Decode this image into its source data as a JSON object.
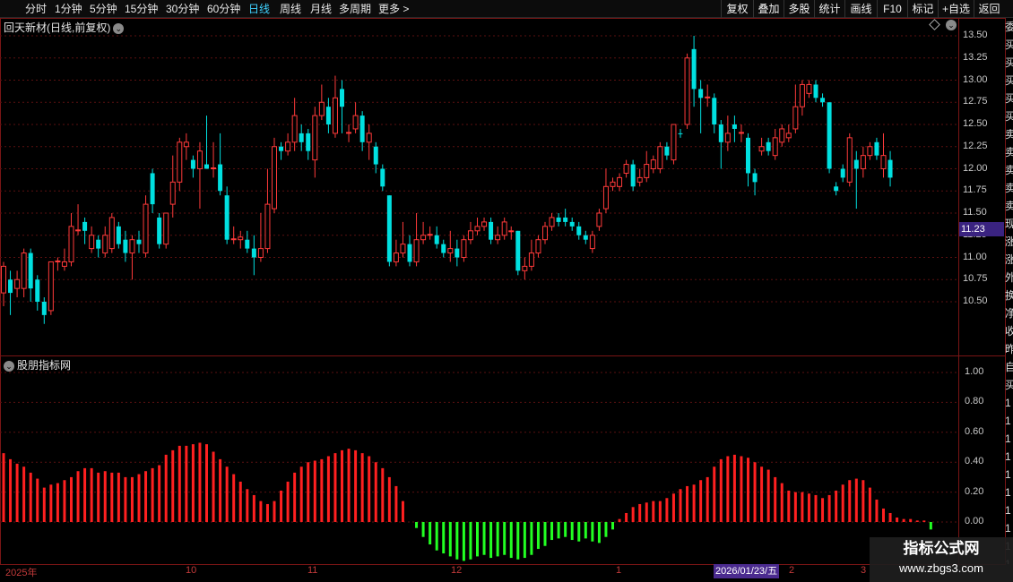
{
  "toolbar": {
    "periods": [
      "分时",
      "1分钟",
      "5分钟",
      "15分钟",
      "30分钟",
      "60分钟",
      "日线",
      "周线",
      "月线",
      "多周期",
      "更多"
    ],
    "active_period": "日线",
    "more_arrow": ">",
    "right_buttons": [
      "复权",
      "叠加",
      "多股",
      "统计",
      "画线",
      "F10",
      "标记",
      "+自选",
      "返回"
    ]
  },
  "main_pane": {
    "title": "回天新材(日线,前复权)",
    "price_ticks": [
      "13.50",
      "13.25",
      "13.00",
      "12.75",
      "12.50",
      "12.25",
      "12.00",
      "11.75",
      "11.50",
      "11.25",
      "11.00",
      "10.75",
      "10.50"
    ],
    "last_price": "11.23"
  },
  "indicator_pane": {
    "title": "股朋指标网",
    "ticks": [
      "1.00",
      "0.80",
      "0.60",
      "0.40",
      "0.20",
      "0.00"
    ]
  },
  "x_axis": {
    "labels": [
      "2025年",
      "10",
      "11",
      "12",
      "1",
      "2",
      "3"
    ],
    "cursor_date": "2026/01/23/五"
  },
  "edge_strip": {
    "chars": [
      "委",
      "买",
      "买",
      "买",
      "买",
      "买",
      "卖",
      "卖",
      "卖",
      "卖",
      "卖",
      "现",
      "涨",
      "涨",
      "外",
      "换",
      "净",
      "收",
      "昨",
      "自",
      "买",
      "1",
      "1",
      "1",
      "1",
      "1",
      "1",
      "1",
      "1",
      "1",
      "1"
    ]
  },
  "watermark": {
    "title": "指标公式网",
    "url": "www.zbgs3.com"
  },
  "colors": {
    "up": "#ff3a3a",
    "down": "#00e0e0",
    "grid": "#5a1010",
    "osc_up": "#ff2020",
    "osc_down": "#22ff22",
    "active_tab": "#3fd2ff"
  },
  "chart_data": [
    {
      "type": "candlestick",
      "title": "回天新材(日线,前复权)",
      "ylim": [
        10.25,
        13.5
      ],
      "candles": [
        {
          "o": 10.6,
          "c": 10.9,
          "h": 10.95,
          "l": 10.45
        },
        {
          "o": 10.75,
          "c": 10.6,
          "h": 10.85,
          "l": 10.35
        },
        {
          "o": 10.65,
          "c": 10.75,
          "h": 10.85,
          "l": 10.55
        },
        {
          "o": 10.65,
          "c": 11.05,
          "h": 11.1,
          "l": 10.55
        },
        {
          "o": 11.05,
          "c": 10.65,
          "h": 11.1,
          "l": 10.5
        },
        {
          "o": 10.75,
          "c": 10.5,
          "h": 10.8,
          "l": 10.4
        },
        {
          "o": 10.5,
          "c": 10.35,
          "h": 10.55,
          "l": 10.25
        },
        {
          "o": 10.4,
          "c": 10.95,
          "h": 10.95,
          "l": 10.35
        },
        {
          "o": 10.95,
          "c": 10.96,
          "h": 11.0,
          "l": 10.85
        },
        {
          "o": 10.9,
          "c": 10.95,
          "h": 11.1,
          "l": 10.85
        },
        {
          "o": 10.95,
          "c": 11.35,
          "h": 11.5,
          "l": 10.9
        },
        {
          "o": 11.3,
          "c": 11.31,
          "h": 11.6,
          "l": 11.25
        },
        {
          "o": 11.4,
          "c": 11.3,
          "h": 11.45,
          "l": 11.15
        },
        {
          "o": 11.1,
          "c": 11.25,
          "h": 11.35,
          "l": 11.05
        },
        {
          "o": 11.2,
          "c": 11.1,
          "h": 11.25,
          "l": 11.0
        },
        {
          "o": 11.05,
          "c": 11.25,
          "h": 11.35,
          "l": 11.0
        },
        {
          "o": 11.1,
          "c": 11.45,
          "h": 11.5,
          "l": 11.05
        },
        {
          "o": 11.35,
          "c": 11.15,
          "h": 11.4,
          "l": 11.1
        },
        {
          "o": 11.2,
          "c": 11.05,
          "h": 11.3,
          "l": 10.95
        },
        {
          "o": 11.05,
          "c": 11.2,
          "h": 11.25,
          "l": 10.75
        },
        {
          "o": 11.2,
          "c": 11.15,
          "h": 11.3,
          "l": 11.05
        },
        {
          "o": 11.05,
          "c": 11.6,
          "h": 11.7,
          "l": 11.0
        },
        {
          "o": 11.95,
          "c": 11.6,
          "h": 12.0,
          "l": 11.5
        },
        {
          "o": 11.45,
          "c": 11.15,
          "h": 11.5,
          "l": 11.1
        },
        {
          "o": 11.15,
          "c": 11.5,
          "h": 11.5,
          "l": 11.1
        },
        {
          "o": 11.6,
          "c": 11.85,
          "h": 12.15,
          "l": 11.45
        },
        {
          "o": 11.85,
          "c": 12.3,
          "h": 12.35,
          "l": 11.75
        },
        {
          "o": 12.25,
          "c": 12.3,
          "h": 12.4,
          "l": 12.1
        },
        {
          "o": 12.1,
          "c": 12.0,
          "h": 12.15,
          "l": 11.9
        },
        {
          "o": 12.0,
          "c": 12.2,
          "h": 12.3,
          "l": 11.55
        },
        {
          "o": 12.05,
          "c": 12.0,
          "h": 12.6,
          "l": 12.0
        },
        {
          "o": 12.0,
          "c": 12.01,
          "h": 12.3,
          "l": 11.9
        },
        {
          "o": 12.05,
          "c": 11.75,
          "h": 12.4,
          "l": 11.7
        },
        {
          "o": 11.7,
          "c": 11.2,
          "h": 11.8,
          "l": 11.15
        },
        {
          "o": 11.2,
          "c": 11.21,
          "h": 11.35,
          "l": 11.15
        },
        {
          "o": 11.2,
          "c": 11.23,
          "h": 11.3,
          "l": 11.1
        },
        {
          "o": 11.2,
          "c": 11.1,
          "h": 11.3,
          "l": 11.05
        },
        {
          "o": 11.1,
          "c": 11.0,
          "h": 11.25,
          "l": 10.8
        },
        {
          "o": 11.0,
          "c": 11.1,
          "h": 11.5,
          "l": 10.95
        },
        {
          "o": 11.1,
          "c": 11.6,
          "h": 12.0,
          "l": 11.05
        },
        {
          "o": 11.55,
          "c": 12.25,
          "h": 12.35,
          "l": 11.5
        },
        {
          "o": 12.25,
          "c": 12.2,
          "h": 12.3,
          "l": 12.1
        },
        {
          "o": 12.2,
          "c": 12.3,
          "h": 12.4,
          "l": 12.15
        },
        {
          "o": 12.3,
          "c": 12.6,
          "h": 12.8,
          "l": 12.2
        },
        {
          "o": 12.4,
          "c": 12.3,
          "h": 12.5,
          "l": 12.2
        },
        {
          "o": 12.4,
          "c": 12.2,
          "h": 12.45,
          "l": 12.1
        },
        {
          "o": 12.1,
          "c": 12.6,
          "h": 12.7,
          "l": 11.9
        },
        {
          "o": 12.6,
          "c": 12.75,
          "h": 12.95,
          "l": 12.55
        },
        {
          "o": 12.7,
          "c": 12.5,
          "h": 12.8,
          "l": 12.4
        },
        {
          "o": 12.4,
          "c": 12.8,
          "h": 13.05,
          "l": 12.35
        },
        {
          "o": 12.9,
          "c": 12.7,
          "h": 13.0,
          "l": 12.4
        },
        {
          "o": 12.4,
          "c": 12.41,
          "h": 12.5,
          "l": 12.3
        },
        {
          "o": 12.45,
          "c": 12.6,
          "h": 12.75,
          "l": 12.4
        },
        {
          "o": 12.6,
          "c": 12.3,
          "h": 12.65,
          "l": 12.2
        },
        {
          "o": 12.3,
          "c": 12.4,
          "h": 12.5,
          "l": 12.1
        },
        {
          "o": 12.25,
          "c": 12.05,
          "h": 12.3,
          "l": 11.95
        },
        {
          "o": 12.0,
          "c": 11.8,
          "h": 12.05,
          "l": 11.75
        },
        {
          "o": 11.7,
          "c": 10.95,
          "h": 11.7,
          "l": 10.9
        },
        {
          "o": 10.95,
          "c": 11.05,
          "h": 11.2,
          "l": 10.9
        },
        {
          "o": 11.05,
          "c": 11.15,
          "h": 11.4,
          "l": 11.0
        },
        {
          "o": 11.15,
          "c": 10.95,
          "h": 11.25,
          "l": 10.9
        },
        {
          "o": 10.95,
          "c": 11.2,
          "h": 11.5,
          "l": 10.9
        },
        {
          "o": 11.2,
          "c": 11.25,
          "h": 11.4,
          "l": 11.15
        },
        {
          "o": 11.25,
          "c": 11.26,
          "h": 11.35,
          "l": 11.2
        },
        {
          "o": 11.25,
          "c": 11.15,
          "h": 11.35,
          "l": 11.1
        },
        {
          "o": 11.15,
          "c": 11.05,
          "h": 11.2,
          "l": 11.0
        },
        {
          "o": 11.05,
          "c": 11.1,
          "h": 11.3,
          "l": 10.95
        },
        {
          "o": 11.1,
          "c": 11.0,
          "h": 11.2,
          "l": 10.9
        },
        {
          "o": 11.0,
          "c": 11.2,
          "h": 11.25,
          "l": 10.95
        },
        {
          "o": 11.2,
          "c": 11.3,
          "h": 11.4,
          "l": 11.15
        },
        {
          "o": 11.3,
          "c": 11.35,
          "h": 11.45,
          "l": 11.25
        },
        {
          "o": 11.35,
          "c": 11.4,
          "h": 11.45,
          "l": 11.3
        },
        {
          "o": 11.4,
          "c": 11.2,
          "h": 11.45,
          "l": 11.15
        },
        {
          "o": 11.2,
          "c": 11.25,
          "h": 11.35,
          "l": 11.15
        },
        {
          "o": 11.25,
          "c": 11.4,
          "h": 11.45,
          "l": 11.2
        },
        {
          "o": 11.3,
          "c": 11.3,
          "h": 11.35,
          "l": 11.2
        },
        {
          "o": 11.3,
          "c": 10.85,
          "h": 11.3,
          "l": 10.8
        },
        {
          "o": 10.85,
          "c": 10.9,
          "h": 11.0,
          "l": 10.75
        },
        {
          "o": 10.9,
          "c": 11.05,
          "h": 11.2,
          "l": 10.85
        },
        {
          "o": 11.05,
          "c": 11.2,
          "h": 11.25,
          "l": 11.0
        },
        {
          "o": 11.2,
          "c": 11.35,
          "h": 11.4,
          "l": 11.15
        },
        {
          "o": 11.35,
          "c": 11.45,
          "h": 11.5,
          "l": 11.3
        },
        {
          "o": 11.45,
          "c": 11.4,
          "h": 11.5,
          "l": 11.35
        },
        {
          "o": 11.45,
          "c": 11.4,
          "h": 11.55,
          "l": 11.35
        },
        {
          "o": 11.4,
          "c": 11.35,
          "h": 11.45,
          "l": 11.3
        },
        {
          "o": 11.35,
          "c": 11.25,
          "h": 11.4,
          "l": 11.2
        },
        {
          "o": 11.25,
          "c": 11.2,
          "h": 11.3,
          "l": 11.15
        },
        {
          "o": 11.1,
          "c": 11.25,
          "h": 11.3,
          "l": 11.05
        },
        {
          "o": 11.35,
          "c": 11.5,
          "h": 11.55,
          "l": 11.3
        },
        {
          "o": 11.55,
          "c": 11.8,
          "h": 12.0,
          "l": 11.5
        },
        {
          "o": 11.8,
          "c": 11.85,
          "h": 11.9,
          "l": 11.75
        },
        {
          "o": 11.8,
          "c": 11.9,
          "h": 11.95,
          "l": 11.75
        },
        {
          "o": 11.95,
          "c": 12.05,
          "h": 12.1,
          "l": 11.9
        },
        {
          "o": 12.05,
          "c": 11.8,
          "h": 12.1,
          "l": 11.75
        },
        {
          "o": 11.85,
          "c": 11.9,
          "h": 12.0,
          "l": 11.8
        },
        {
          "o": 11.9,
          "c": 12.05,
          "h": 12.2,
          "l": 11.85
        },
        {
          "o": 12.0,
          "c": 12.1,
          "h": 12.15,
          "l": 11.95
        },
        {
          "o": 12.0,
          "c": 12.25,
          "h": 12.3,
          "l": 11.95
        },
        {
          "o": 12.25,
          "c": 12.15,
          "h": 12.3,
          "l": 12.1
        },
        {
          "o": 12.1,
          "c": 12.5,
          "h": 12.5,
          "l": 12.05
        },
        {
          "o": 12.4,
          "c": 12.39,
          "h": 12.45,
          "l": 12.35
        },
        {
          "o": 12.5,
          "c": 13.25,
          "h": 13.3,
          "l": 12.45
        },
        {
          "o": 13.35,
          "c": 12.9,
          "h": 13.5,
          "l": 12.7
        },
        {
          "o": 12.9,
          "c": 12.8,
          "h": 13.0,
          "l": 12.4
        },
        {
          "o": 12.8,
          "c": 12.81,
          "h": 12.95,
          "l": 12.7
        },
        {
          "o": 12.8,
          "c": 12.5,
          "h": 12.85,
          "l": 12.4
        },
        {
          "o": 12.5,
          "c": 12.3,
          "h": 12.55,
          "l": 12.0
        },
        {
          "o": 12.3,
          "c": 12.4,
          "h": 12.6,
          "l": 12.2
        },
        {
          "o": 12.5,
          "c": 12.45,
          "h": 12.6,
          "l": 12.3
        },
        {
          "o": 12.4,
          "c": 12.41,
          "h": 12.5,
          "l": 12.3
        },
        {
          "o": 12.35,
          "c": 11.95,
          "h": 12.4,
          "l": 11.8
        },
        {
          "o": 11.95,
          "c": 11.85,
          "h": 12.0,
          "l": 11.7
        },
        {
          "o": 12.2,
          "c": 12.25,
          "h": 12.35,
          "l": 12.15
        },
        {
          "o": 12.3,
          "c": 12.2,
          "h": 12.35,
          "l": 12.15
        },
        {
          "o": 12.15,
          "c": 12.35,
          "h": 12.45,
          "l": 12.1
        },
        {
          "o": 12.3,
          "c": 12.45,
          "h": 12.5,
          "l": 12.25
        },
        {
          "o": 12.35,
          "c": 12.4,
          "h": 12.5,
          "l": 12.3
        },
        {
          "o": 12.45,
          "c": 12.7,
          "h": 12.95,
          "l": 12.4
        },
        {
          "o": 12.7,
          "c": 12.95,
          "h": 13.0,
          "l": 12.6
        },
        {
          "o": 12.85,
          "c": 12.95,
          "h": 13.0,
          "l": 12.8
        },
        {
          "o": 12.95,
          "c": 12.8,
          "h": 13.0,
          "l": 12.75
        },
        {
          "o": 12.8,
          "c": 12.75,
          "h": 12.85,
          "l": 12.7
        },
        {
          "o": 12.75,
          "c": 12.0,
          "h": 12.75,
          "l": 11.95
        },
        {
          "o": 11.8,
          "c": 11.75,
          "h": 11.85,
          "l": 11.7
        },
        {
          "o": 12.0,
          "c": 11.9,
          "h": 12.05,
          "l": 11.85
        },
        {
          "o": 11.85,
          "c": 12.35,
          "h": 12.4,
          "l": 11.8
        },
        {
          "o": 12.1,
          "c": 12.0,
          "h": 12.2,
          "l": 11.55
        },
        {
          "o": 12.0,
          "c": 12.15,
          "h": 12.25,
          "l": 11.9
        },
        {
          "o": 12.15,
          "c": 12.25,
          "h": 12.3,
          "l": 12.1
        },
        {
          "o": 12.3,
          "c": 12.15,
          "h": 12.35,
          "l": 12.1
        },
        {
          "o": 12.0,
          "c": 12.15,
          "h": 12.4,
          "l": 11.9
        },
        {
          "o": 12.1,
          "c": 11.9,
          "h": 12.2,
          "l": 11.8
        }
      ]
    },
    {
      "type": "bar",
      "title": "股朋指标网",
      "ylim": [
        -0.3,
        1.05
      ],
      "values": [
        0.46,
        0.42,
        0.39,
        0.37,
        0.33,
        0.29,
        0.23,
        0.25,
        0.26,
        0.28,
        0.3,
        0.34,
        0.36,
        0.36,
        0.33,
        0.34,
        0.33,
        0.33,
        0.3,
        0.3,
        0.32,
        0.34,
        0.36,
        0.38,
        0.45,
        0.48,
        0.51,
        0.51,
        0.52,
        0.53,
        0.52,
        0.47,
        0.42,
        0.37,
        0.32,
        0.27,
        0.22,
        0.18,
        0.14,
        0.12,
        0.14,
        0.21,
        0.27,
        0.33,
        0.37,
        0.4,
        0.41,
        0.42,
        0.44,
        0.46,
        0.48,
        0.49,
        0.48,
        0.46,
        0.44,
        0.4,
        0.36,
        0.3,
        0.24,
        0.14,
        0.0,
        -0.04,
        -0.1,
        -0.15,
        -0.19,
        -0.21,
        -0.23,
        -0.25,
        -0.26,
        -0.25,
        -0.23,
        -0.22,
        -0.24,
        -0.23,
        -0.22,
        -0.24,
        -0.25,
        -0.24,
        -0.22,
        -0.18,
        -0.16,
        -0.12,
        -0.11,
        -0.1,
        -0.12,
        -0.13,
        -0.11,
        -0.13,
        -0.14,
        -0.1,
        -0.05,
        0.02,
        0.06,
        0.1,
        0.12,
        0.13,
        0.14,
        0.14,
        0.16,
        0.19,
        0.22,
        0.24,
        0.25,
        0.28,
        0.3,
        0.37,
        0.42,
        0.44,
        0.45,
        0.44,
        0.43,
        0.4,
        0.37,
        0.35,
        0.3,
        0.26,
        0.21,
        0.2,
        0.2,
        0.19,
        0.18,
        0.16,
        0.18,
        0.21,
        0.25,
        0.28,
        0.29,
        0.28,
        0.23,
        0.15,
        0.09,
        0.06,
        0.03,
        0.02,
        0.02,
        0.01,
        0.01,
        -0.05
      ]
    }
  ]
}
